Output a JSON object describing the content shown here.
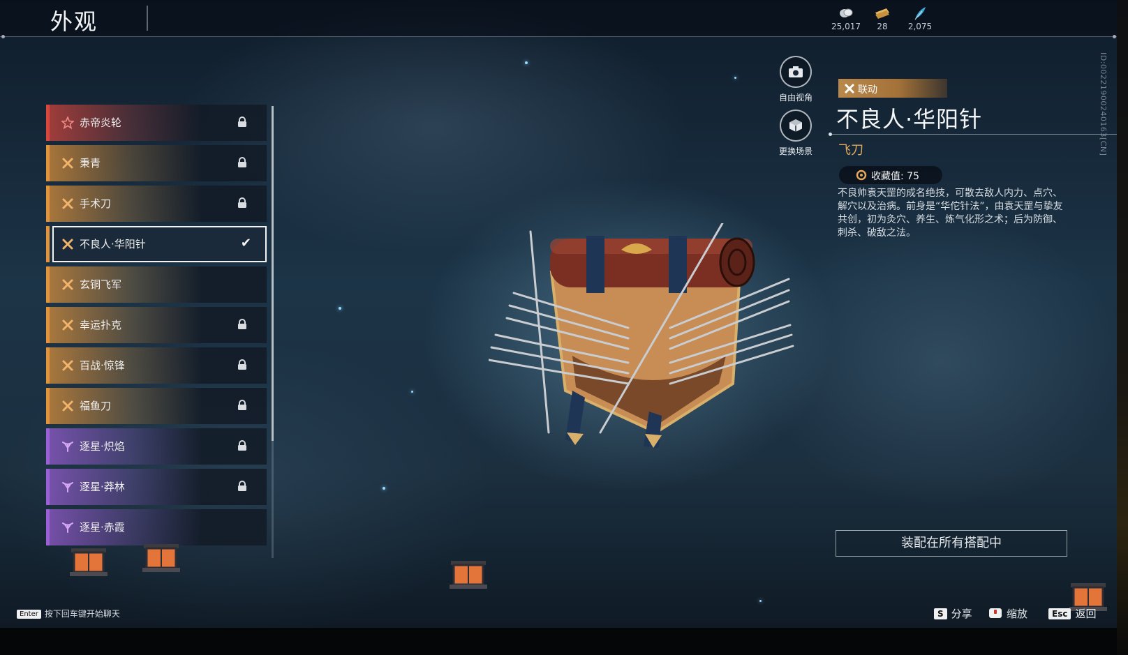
{
  "header": {
    "title": "外观",
    "currencies": [
      {
        "icon": "coin-icon",
        "value": "25,017"
      },
      {
        "icon": "ticket-icon",
        "value": "28"
      },
      {
        "icon": "feather-icon",
        "value": "2,075"
      }
    ]
  },
  "build_id": "ID:00221900240163[CN]",
  "list": {
    "items": [
      {
        "label": "赤帝炎轮",
        "rarity_color": "#d8463c",
        "rarity_icon": "star-icon",
        "locked": true,
        "selected": false
      },
      {
        "label": "秉青",
        "rarity_color": "#e3943a",
        "rarity_icon": "crossed-blades-icon",
        "locked": true,
        "selected": false
      },
      {
        "label": "手术刀",
        "rarity_color": "#e3943a",
        "rarity_icon": "crossed-blades-icon",
        "locked": true,
        "selected": false
      },
      {
        "label": "不良人·华阳针",
        "rarity_color": "#e3943a",
        "rarity_icon": "crossed-blades-icon",
        "locked": false,
        "selected": true
      },
      {
        "label": "玄铜飞军",
        "rarity_color": "#e3943a",
        "rarity_icon": "crossed-blades-icon",
        "locked": false,
        "selected": false
      },
      {
        "label": "幸运扑克",
        "rarity_color": "#e3943a",
        "rarity_icon": "crossed-blades-icon",
        "locked": true,
        "selected": false
      },
      {
        "label": "百战·惊锋",
        "rarity_color": "#e3943a",
        "rarity_icon": "crossed-blades-icon",
        "locked": true,
        "selected": false
      },
      {
        "label": "福鱼刀",
        "rarity_color": "#e3943a",
        "rarity_icon": "crossed-blades-icon",
        "locked": true,
        "selected": false
      },
      {
        "label": "逐星·炽焰",
        "rarity_color": "#9b5fd6",
        "rarity_icon": "trident-icon",
        "locked": true,
        "selected": false
      },
      {
        "label": "逐星·莽林",
        "rarity_color": "#9b5fd6",
        "rarity_icon": "trident-icon",
        "locked": true,
        "selected": false
      },
      {
        "label": "逐星·赤霞",
        "rarity_color": "#9b5fd6",
        "rarity_icon": "trident-icon",
        "locked": false,
        "selected": false
      }
    ]
  },
  "camera": {
    "free_view_label": "自由视角",
    "change_scene_label": "更换场景"
  },
  "detail": {
    "tag_label": "联动",
    "name": "不良人·华阳针",
    "type": "飞刀",
    "collect_label": "收藏值: 75",
    "description": "不良帅袁天罡的成名绝技，可散去敌人内力、点穴、解穴以及治病。前身是“华佗针法”，由袁天罡与挚友共创，初为灸穴、养生、炼气化形之术；后为防御、刺杀、破敌之法。",
    "equip_button": "装配在所有搭配中"
  },
  "footer": {
    "chat_key": "Enter",
    "chat_hint": "按下回车键开始聊天",
    "share_key": "S",
    "share_label": "分享",
    "zoom_label": "缩放",
    "back_key": "Esc",
    "back_label": "返回"
  },
  "colors": {
    "accent_gold": "#e2a95a",
    "rarity_red": "#d8463c",
    "rarity_orange": "#e3943a",
    "rarity_purple": "#9b5fd6"
  }
}
